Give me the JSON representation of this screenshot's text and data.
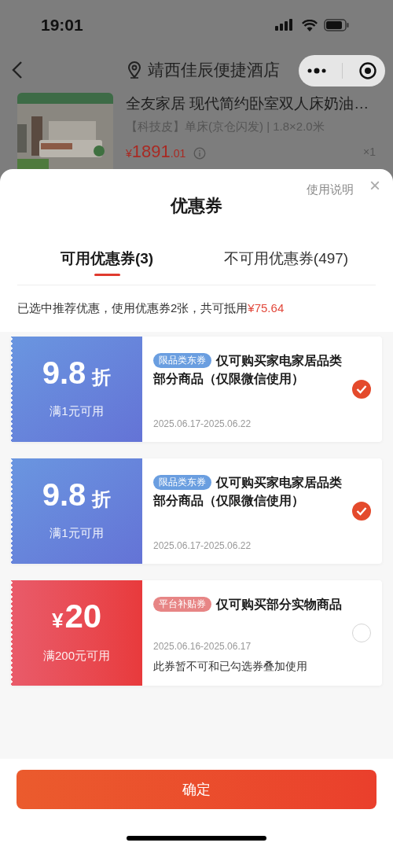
{
  "status_bar": {
    "time": "19:01"
  },
  "nav": {
    "title": "靖西佳辰便捷酒店"
  },
  "product": {
    "kind": "picture",
    "title": "全友家居 现代简约卧室双人床奶油…",
    "spec": "【科技皮】单床(京仓闪发) | 1.8×2.0米",
    "price_symbol": "¥",
    "price_int": "1891",
    "price_dec": ".01",
    "quantity": "×1"
  },
  "sheet": {
    "title": "优惠券",
    "help": "使用说明",
    "close": "×",
    "tabs": [
      {
        "label": "可用优惠券(3)",
        "selected": true
      },
      {
        "label": "不可用优惠券(497)",
        "selected": false
      }
    ],
    "summary": "已选中推荐优惠，使用优惠券2张，共可抵用",
    "summary_amount": "¥75.64",
    "coupons": [
      {
        "kind": "discount",
        "amount": "9.8",
        "unit": "折",
        "threshold": "满1元可用",
        "tag": "限品类东券",
        "color": "#6a9ee0",
        "desc": "仅可购买家电家居品类部分商品（仅限微信使用）",
        "dates": "2025.06.17-2025.06.22",
        "selected": true
      },
      {
        "kind": "discount",
        "amount": "9.8",
        "unit": "折",
        "threshold": "满1元可用",
        "tag": "限品类东券",
        "color": "#6a9ee0",
        "desc": "仅可购买家电家居品类部分商品（仅限微信使用）",
        "dates": "2025.06.17-2025.06.22",
        "selected": true
      },
      {
        "kind": "cash",
        "currency": "¥",
        "amount": "20",
        "threshold": "满200元可用",
        "tag": "平台补贴券",
        "color": "#e78585",
        "desc": "仅可购买部分实物商品",
        "dates": "2025.06.16-2025.06.17",
        "note": "此券暂不可和已勾选券叠加使用",
        "selected": false
      }
    ],
    "confirm": "确定"
  }
}
